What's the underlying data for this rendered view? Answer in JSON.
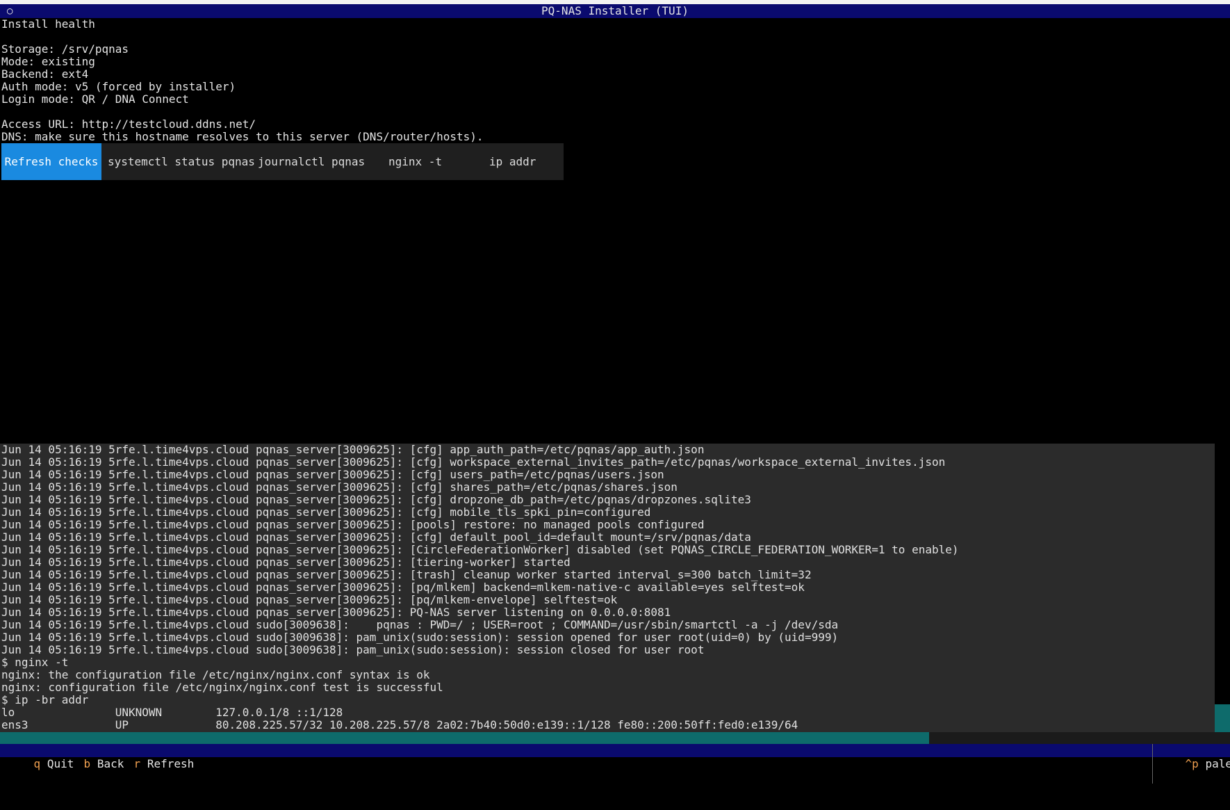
{
  "window": {
    "title": "PQ-NAS Installer (TUI)"
  },
  "info": {
    "heading": "Install health",
    "storage": "Storage: /srv/pqnas",
    "mode": "Mode: existing",
    "backend": "Backend: ext4",
    "auth_mode": "Auth mode: v5 (forced by installer)",
    "login_mode": "Login mode: QR / DNA Connect",
    "access_url": "Access URL: http://testcloud.ddns.net/",
    "dns_note": "DNS: make sure this hostname resolves to this server (DNS/router/hosts)."
  },
  "actions": {
    "refresh": "Refresh checks",
    "systemctl": "systemctl status pqnas",
    "journalctl": "journalctl pqnas",
    "nginx": "nginx -t",
    "ipaddr": "ip addr"
  },
  "log_lines": [
    "Jun 14 05:16:19 5rfe.l.time4vps.cloud pqnas_server[3009625]: [cfg] app_auth_path=/etc/pqnas/app_auth.json",
    "Jun 14 05:16:19 5rfe.l.time4vps.cloud pqnas_server[3009625]: [cfg] workspace_external_invites_path=/etc/pqnas/workspace_external_invites.json",
    "Jun 14 05:16:19 5rfe.l.time4vps.cloud pqnas_server[3009625]: [cfg] users_path=/etc/pqnas/users.json",
    "Jun 14 05:16:19 5rfe.l.time4vps.cloud pqnas_server[3009625]: [cfg] shares_path=/etc/pqnas/shares.json",
    "Jun 14 05:16:19 5rfe.l.time4vps.cloud pqnas_server[3009625]: [cfg] dropzone_db_path=/etc/pqnas/dropzones.sqlite3",
    "Jun 14 05:16:19 5rfe.l.time4vps.cloud pqnas_server[3009625]: [cfg] mobile_tls_spki_pin=configured",
    "Jun 14 05:16:19 5rfe.l.time4vps.cloud pqnas_server[3009625]: [pools] restore: no managed pools configured",
    "Jun 14 05:16:19 5rfe.l.time4vps.cloud pqnas_server[3009625]: [cfg] default_pool_id=default mount=/srv/pqnas/data",
    "Jun 14 05:16:19 5rfe.l.time4vps.cloud pqnas_server[3009625]: [CircleFederationWorker] disabled (set PQNAS_CIRCLE_FEDERATION_WORKER=1 to enable)",
    "Jun 14 05:16:19 5rfe.l.time4vps.cloud pqnas_server[3009625]: [tiering-worker] started",
    "Jun 14 05:16:19 5rfe.l.time4vps.cloud pqnas_server[3009625]: [trash] cleanup worker started interval_s=300 batch_limit=32",
    "Jun 14 05:16:19 5rfe.l.time4vps.cloud pqnas_server[3009625]: [pq/mlkem] backend=mlkem-native-c available=yes selftest=ok",
    "Jun 14 05:16:19 5rfe.l.time4vps.cloud pqnas_server[3009625]: [pq/mlkem-envelope] selftest=ok",
    "Jun 14 05:16:19 5rfe.l.time4vps.cloud pqnas_server[3009625]: PQ-NAS server listening on 0.0.0.0:8081",
    "Jun 14 05:16:19 5rfe.l.time4vps.cloud sudo[3009638]:    pqnas : PWD=/ ; USER=root ; COMMAND=/usr/sbin/smartctl -a -j /dev/sda",
    "Jun 14 05:16:19 5rfe.l.time4vps.cloud sudo[3009638]: pam_unix(sudo:session): session opened for user root(uid=0) by (uid=999)",
    "Jun 14 05:16:19 5rfe.l.time4vps.cloud sudo[3009638]: pam_unix(sudo:session): session closed for user root",
    "$ nginx -t",
    "nginx: the configuration file /etc/nginx/nginx.conf syntax is ok",
    "nginx: configuration file /etc/nginx/nginx.conf test is successful",
    "$ ip -br addr",
    "lo               UNKNOWN        127.0.0.1/8 ::1/128",
    "ens3             UP             80.208.225.57/32 10.208.225.57/8 2a02:7b40:50d0:e139::1/128 fe80::200:50ff:fed0:e139/64"
  ],
  "statusbar": {
    "quit_key": "q",
    "quit_label": "Quit",
    "back_key": "b",
    "back_label": "Back",
    "refresh_key": "r",
    "refresh_label": "Refresh",
    "palette_key": "^p",
    "palette_label": "palette"
  },
  "colors": {
    "title_bar": "#0a0a6e",
    "active_button": "#1a8ae0",
    "scroll_thumb": "#0e6b6b",
    "key_hint": "#f0a050"
  }
}
